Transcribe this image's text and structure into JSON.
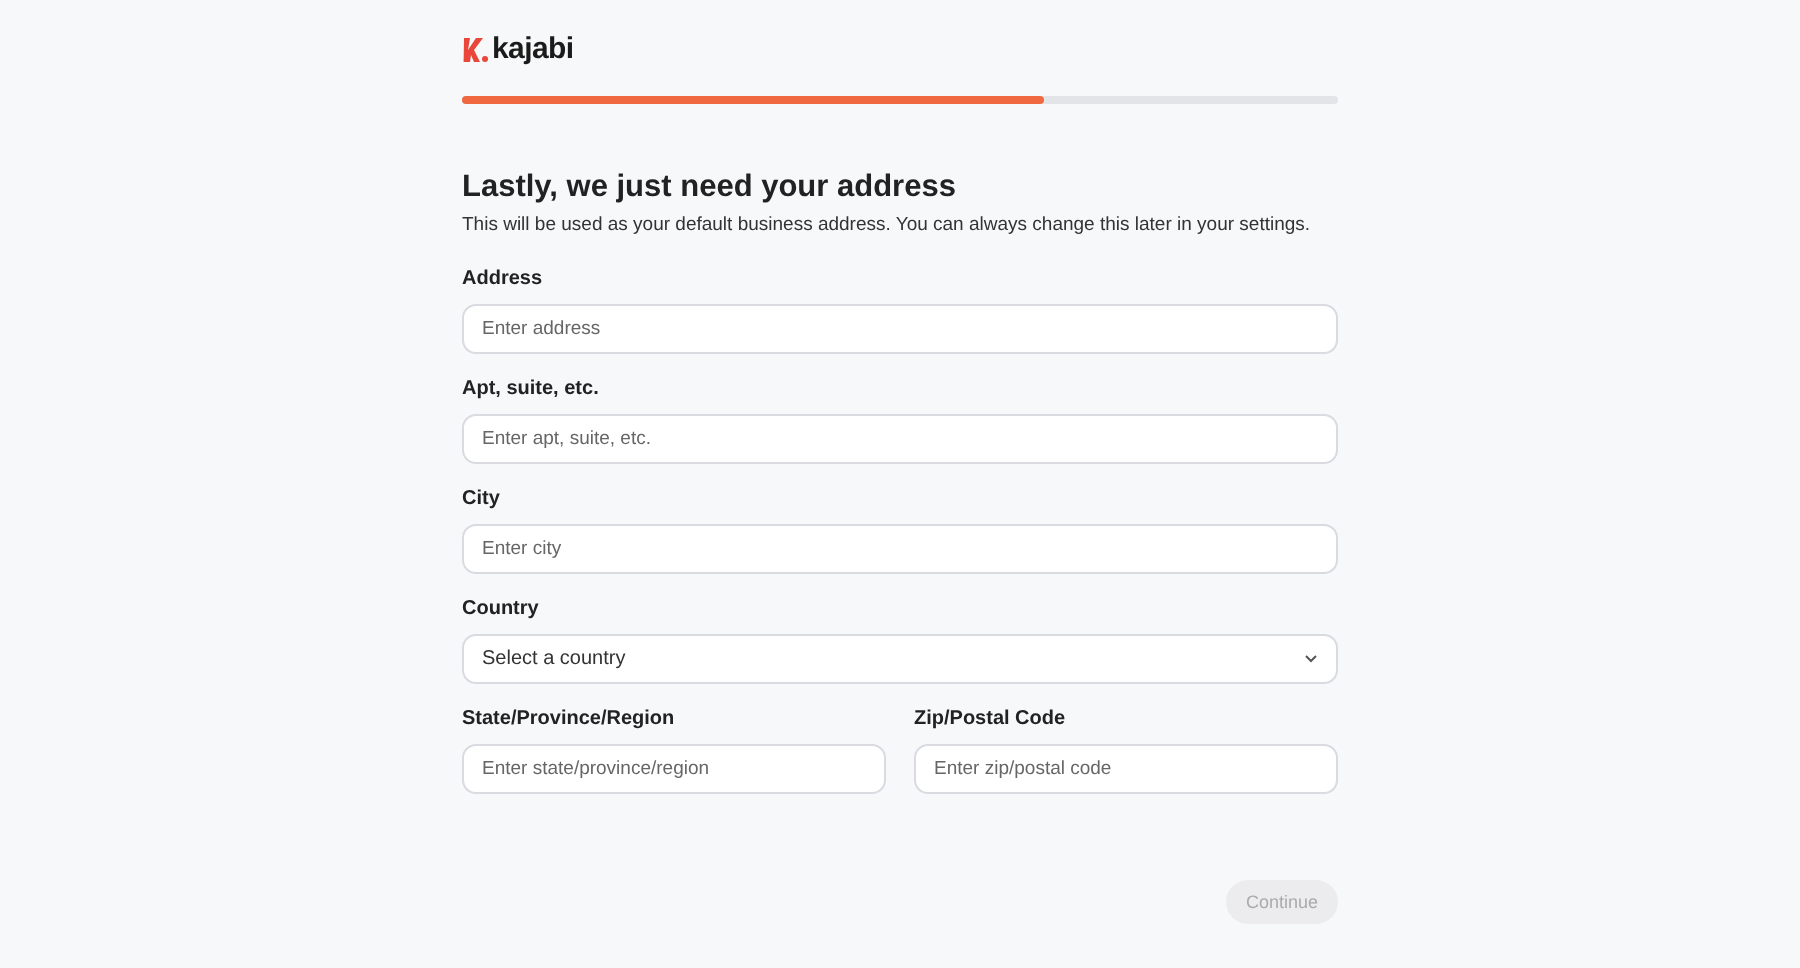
{
  "brand": {
    "name": "kajabi"
  },
  "progress": {
    "level": 0.665
  },
  "heading": "Lastly, we just need your address",
  "subtitle": "This will be used as your default business address. You can always change this later in your settings.",
  "rows": [
    {
      "fields": [
        {
          "label": "Address",
          "kind": "text",
          "placeholder": "Enter address"
        }
      ]
    },
    {
      "fields": [
        {
          "label": "Apt, suite, etc.",
          "kind": "text",
          "placeholder": "Enter apt, suite, etc."
        }
      ]
    },
    {
      "fields": [
        {
          "label": "City",
          "kind": "text",
          "placeholder": "Enter city"
        }
      ]
    },
    {
      "fields": [
        {
          "label": "Country",
          "kind": "select",
          "placeholder": "Select a country"
        }
      ]
    },
    {
      "fields": [
        {
          "label": "State/Province/Region",
          "kind": "text",
          "placeholder": "Enter state/province/region"
        },
        {
          "label": "Zip/Postal Code",
          "kind": "text",
          "placeholder": "Enter zip/postal code"
        }
      ]
    }
  ],
  "continue_button": {
    "label": "Continue",
    "disabled": true
  }
}
